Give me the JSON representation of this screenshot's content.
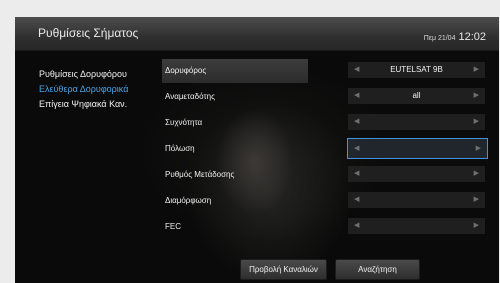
{
  "header": {
    "title": "Ρυθμίσεις Σήματος",
    "date": "Πεμ 21/04",
    "time": "12:02"
  },
  "sidebar": {
    "items": [
      {
        "label": "Ρυθμίσεις Δορυφόρου",
        "active": false
      },
      {
        "label": "Ελεύθερα Δορυφορικά",
        "active": true
      },
      {
        "label": "Επίγεια Ψηφιακά Καν.",
        "active": false
      }
    ]
  },
  "rows": [
    {
      "label": "Δορυφόρος",
      "value": "EUTELSAT 9B"
    },
    {
      "label": "Αναμεταδότης",
      "value": "all"
    },
    {
      "label": "Συχνότητα",
      "value": ""
    },
    {
      "label": "Πόλωση",
      "value": ""
    },
    {
      "label": "Ρυθμός Μετάδοσης",
      "value": ""
    },
    {
      "label": "Διαμόρφωση",
      "value": ""
    },
    {
      "label": "FEC",
      "value": ""
    }
  ],
  "buttons": {
    "view_channels": "Προβολή Καναλιών",
    "search": "Αναζήτηση"
  },
  "colors": {
    "accent": "#3f95e0",
    "active_text": "#4aa3e8"
  }
}
